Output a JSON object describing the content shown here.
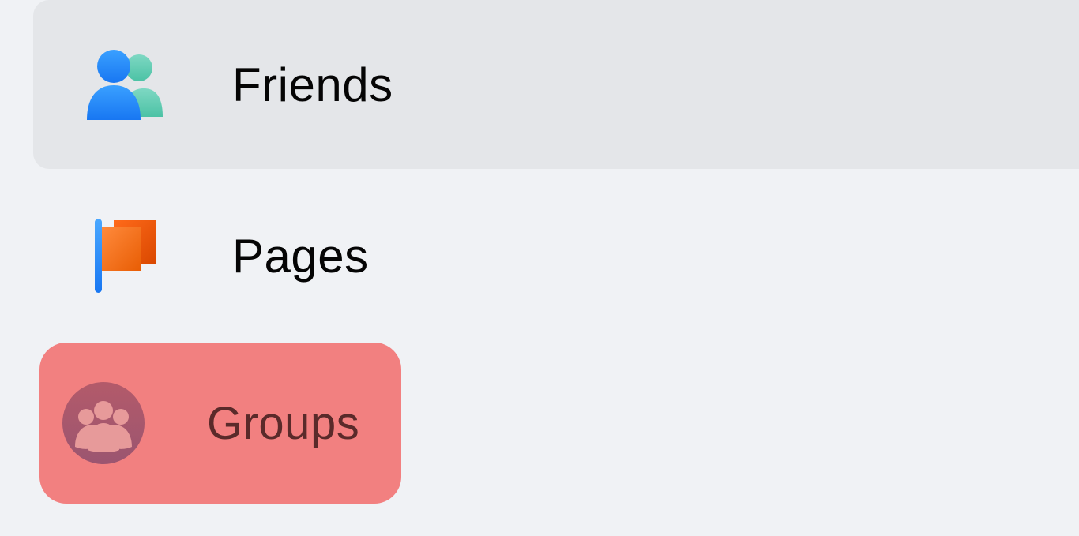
{
  "sidebar": {
    "items": [
      {
        "label": "Friends",
        "icon": "friends-icon",
        "state": "hover"
      },
      {
        "label": "Pages",
        "icon": "pages-icon",
        "state": "normal"
      },
      {
        "label": "Groups",
        "icon": "groups-icon",
        "state": "highlighted"
      }
    ]
  }
}
